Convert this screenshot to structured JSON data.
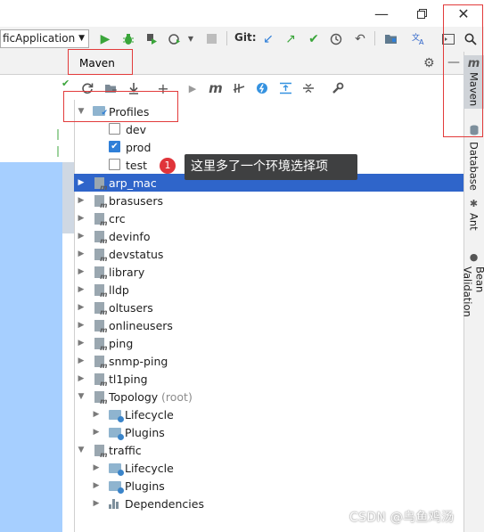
{
  "toolbar": {
    "run_config": "ficApplication",
    "git_label": "Git:"
  },
  "maven": {
    "title": "Maven"
  },
  "tree": {
    "profiles_label": "Profiles",
    "profiles": [
      {
        "label": "dev",
        "checked": false
      },
      {
        "label": "prod",
        "checked": true
      },
      {
        "label": "test",
        "checked": false
      }
    ],
    "modules": [
      "arp_mac",
      "brasusers",
      "crc",
      "devinfo",
      "devstatus",
      "library",
      "lldp",
      "oltusers",
      "onlineusers",
      "ping",
      "snmp-ping",
      "tl1ping"
    ],
    "topology": {
      "label": "Topology",
      "root_suffix": "(root)",
      "children": [
        "Lifecycle",
        "Plugins"
      ]
    },
    "traffic": {
      "label": "traffic",
      "children": [
        "Lifecycle",
        "Plugins",
        "Dependencies"
      ]
    }
  },
  "callout": {
    "number": "1",
    "text": "这里多了一个环境选择项"
  },
  "right_stripe": {
    "tabs": [
      "Maven",
      "Database",
      "Ant",
      "Bean Validation"
    ]
  },
  "watermark": "CSDN @乌鱼鸡汤",
  "colors": {
    "selection": "#2f65ca",
    "annotation_red": "#e23b3b",
    "callout_bg": "#3f4041",
    "checkbox_on": "#2f7fd8"
  }
}
